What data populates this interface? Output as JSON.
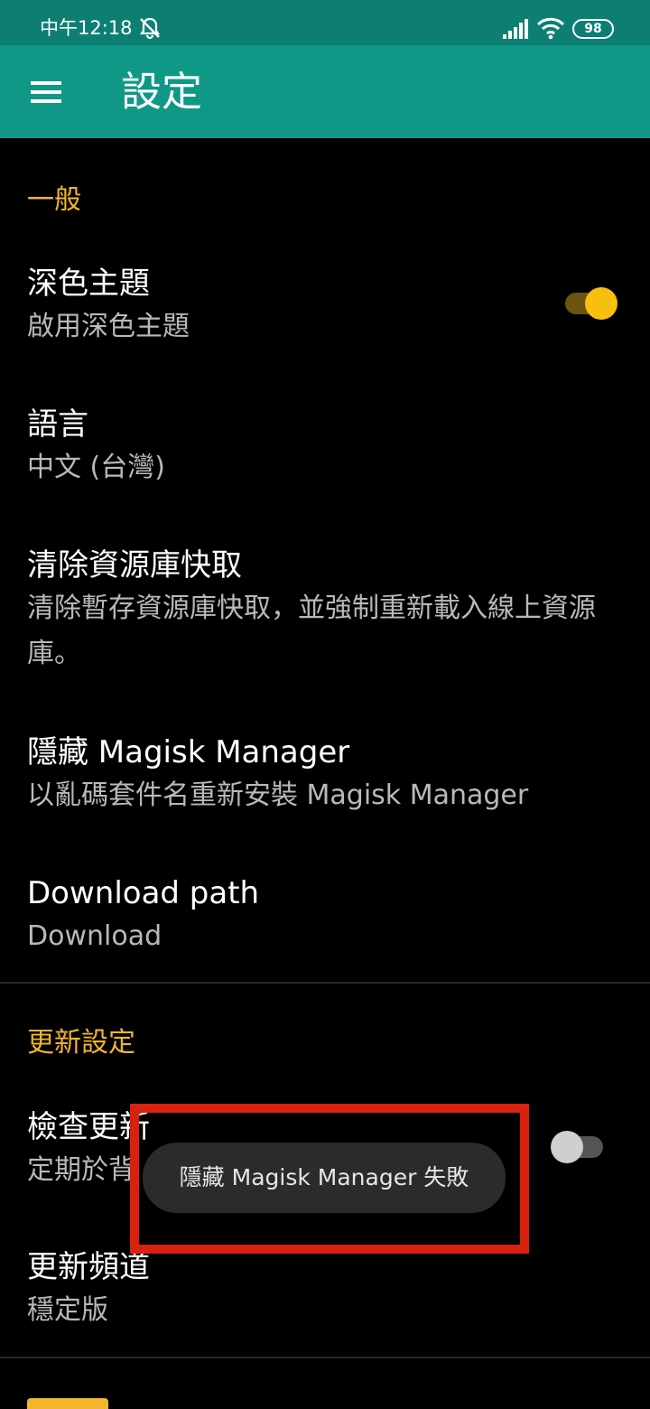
{
  "status_bar": {
    "time": "中午12:18",
    "battery": "98",
    "icons": [
      "bell-off-icon",
      "signal-icon",
      "wifi-icon",
      "battery-icon"
    ]
  },
  "app_bar": {
    "title": "設定",
    "menu_icon": "hamburger-menu-icon"
  },
  "sections": {
    "general": {
      "header": "一般"
    },
    "update": {
      "header": "更新設定"
    }
  },
  "prefs": {
    "dark_theme": {
      "title": "深色主題",
      "summary": "啟用深色主題",
      "enabled": true
    },
    "language": {
      "title": "語言",
      "summary": "中文 (台灣)"
    },
    "clear_cache": {
      "title": "清除資源庫快取",
      "summary": "清除暫存資源庫快取，並強制重新載入線上資源庫。"
    },
    "hide_manager": {
      "title": "隱藏 Magisk Manager",
      "summary": "以亂碼套件名重新安裝 Magisk Manager"
    },
    "download_path": {
      "title": "Download path",
      "summary": "Download"
    },
    "check_updates": {
      "title": "檢查更新",
      "summary": "定期於背",
      "enabled": false
    },
    "update_channel": {
      "title": "更新頻道",
      "summary": "穩定版"
    }
  },
  "toast": {
    "message": "隱藏 Magisk Manager 失敗"
  },
  "colors": {
    "status_bar": "#0d7f72",
    "app_bar": "#0f9886",
    "accent": "#f3b52c",
    "switch_on": "#f8bf0e",
    "highlight": "#d8220f"
  }
}
